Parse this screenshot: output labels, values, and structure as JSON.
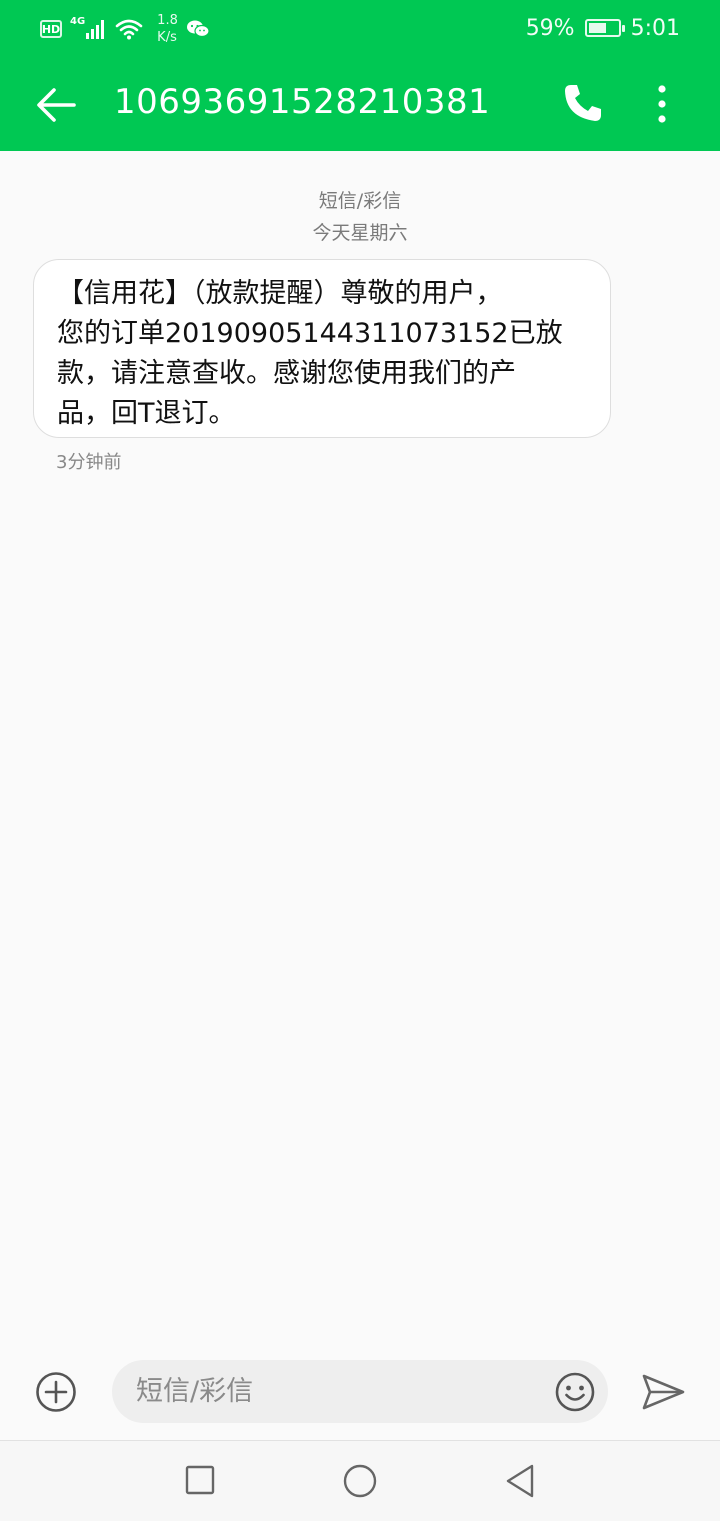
{
  "status_bar": {
    "hd_badge": "HD",
    "network_type": "4G",
    "speed_value": "1.8",
    "speed_unit": "K/s",
    "battery_percent": "59%",
    "battery_level": 0.59,
    "time": "5:01",
    "icons": [
      "hd-icon",
      "signal-icon",
      "wifi-icon",
      "wechat-icon",
      "battery-icon"
    ]
  },
  "header": {
    "title": "10693691528210381",
    "back_icon": "arrow-left-icon",
    "call_icon": "phone-icon",
    "more_icon": "more-vertical-icon"
  },
  "conversation": {
    "channel_label": "短信/彩信",
    "date_label": "今天星期六",
    "message": {
      "text": "【信用花】（放款提醒）尊敬的用户，您的订单20190905144311073152已放款，请注意查收。感谢您使用我们的产品，回T退订。",
      "line1": "【信用花】（放款提醒）尊敬的用户，",
      "line2": "您的订单20190905144311073152已放",
      "line3": "款，请注意查收。感谢您使用我们的产",
      "line4": "品，回T退订。",
      "time": "3分钟前"
    }
  },
  "composer": {
    "placeholder": "短信/彩信",
    "value": "",
    "add_icon": "add-circle-icon",
    "emoji_icon": "smiley-icon",
    "send_icon": "send-icon"
  },
  "nav": {
    "icons": [
      "recent-apps-icon",
      "home-icon",
      "back-triangle-icon"
    ]
  },
  "colors": {
    "header_bg": "#00c853",
    "page_bg": "#fafafa",
    "bubble_bg": "#ffffff"
  }
}
